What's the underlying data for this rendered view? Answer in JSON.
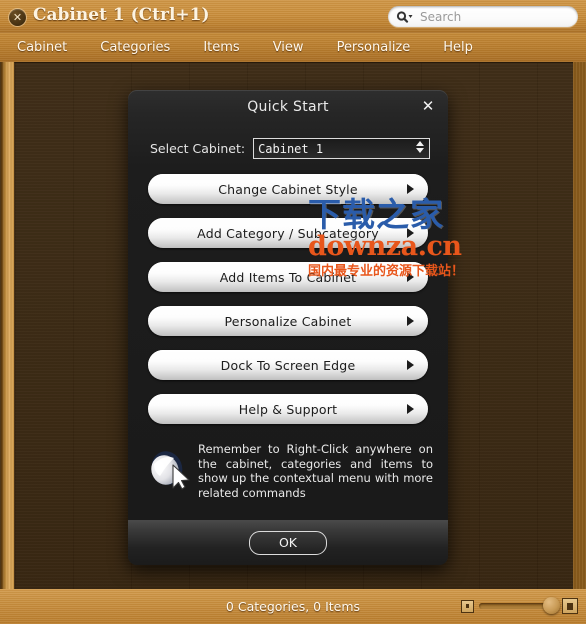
{
  "window": {
    "title": "Cabinet 1  (Ctrl+1)",
    "close_label": "✕",
    "close_icon": "close-icon"
  },
  "search": {
    "placeholder": "Search",
    "icon": "search-icon"
  },
  "menubar": {
    "items": [
      {
        "label": "Cabinet"
      },
      {
        "label": "Categories"
      },
      {
        "label": "Items"
      },
      {
        "label": "View"
      },
      {
        "label": "Personalize"
      },
      {
        "label": "Help"
      }
    ]
  },
  "dialog": {
    "title": "Quick Start",
    "close_label": "✕",
    "select": {
      "label": "Select Cabinet:",
      "value": "Cabinet 1"
    },
    "buttons": [
      {
        "label": "Change Cabinet Style",
        "arrow": true
      },
      {
        "label": "Add Category / Subcategory",
        "arrow": true
      },
      {
        "label": "Add Items To Cabinet",
        "arrow": true
      },
      {
        "label": "Personalize Cabinet",
        "arrow": true
      },
      {
        "label": "Dock To Screen Edge",
        "arrow": true
      },
      {
        "label": "Help & Support",
        "arrow": true
      }
    ],
    "hint": {
      "icon": "mouse-icon",
      "text": "Remember to Right-Click anywhere on the cabinet, categories and items to show up the contextual menu with more related commands"
    },
    "ok_label": "OK"
  },
  "statusbar": {
    "text": "0 Categories, 0 Items",
    "zoom_small_icon": "small-icon-view",
    "zoom_large_icon": "large-icon-view"
  },
  "watermark": {
    "line1": "下载之家",
    "line2": "downza.cn",
    "line3": "国内最专业的资源下载站！"
  },
  "colors": {
    "wood_light": "#c98e3c",
    "wood_dark": "#3b2913",
    "dialog_bg": "#1d1d1d",
    "watermark_blue": "#2a5caa",
    "watermark_orange": "#e8561b"
  }
}
